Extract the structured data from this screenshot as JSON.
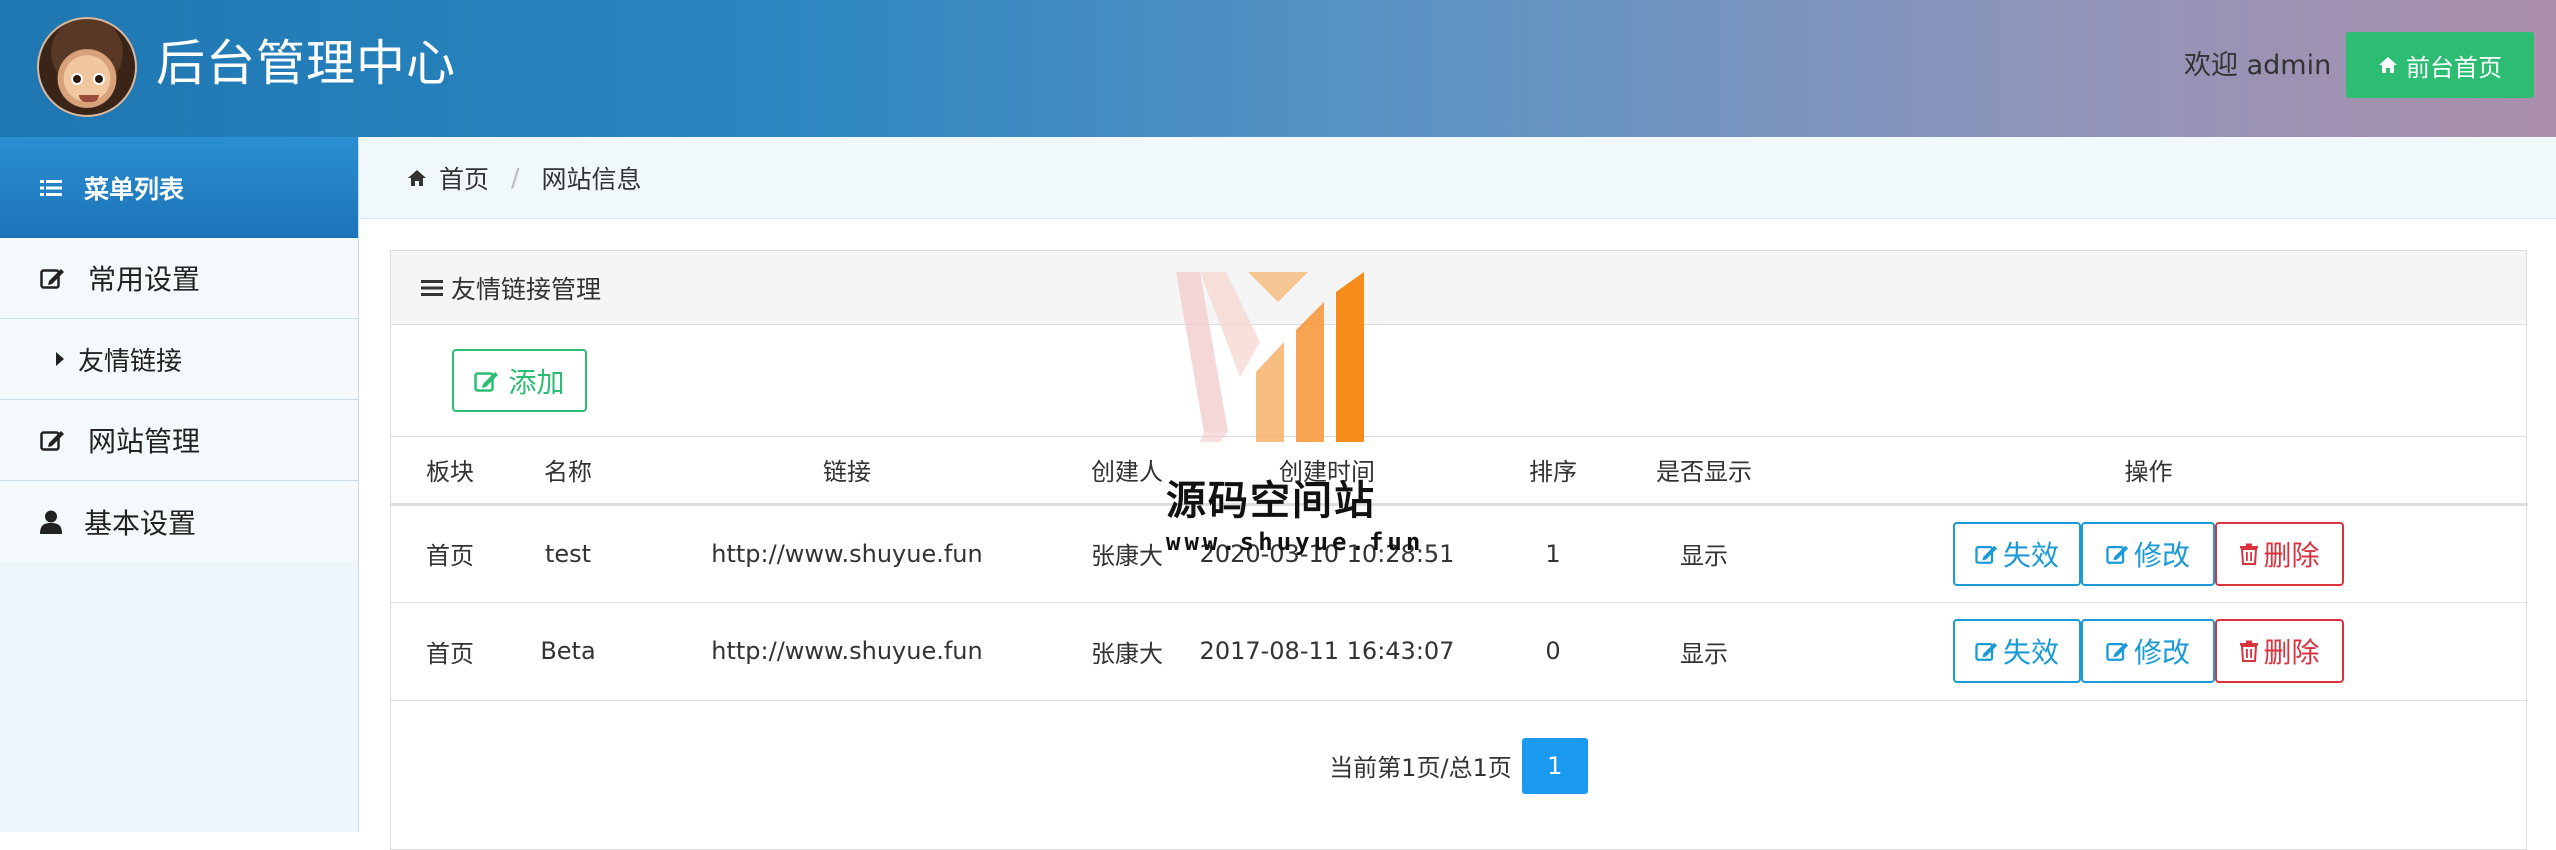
{
  "header": {
    "site_title": "后台管理中心",
    "welcome": "欢迎 admin",
    "front_button": "前台首页"
  },
  "sidebar": {
    "title": "菜单列表",
    "items": [
      {
        "label": "常用设置",
        "icon": "edit-icon"
      },
      {
        "label": "友情链接",
        "icon": "caret-right-icon",
        "sub": true
      },
      {
        "label": "网站管理",
        "icon": "edit-icon"
      },
      {
        "label": "基本设置",
        "icon": "user-icon"
      }
    ]
  },
  "breadcrumb": {
    "home": "首页",
    "current": "网站信息"
  },
  "panel": {
    "title": "友情链接管理",
    "add_button": "添加"
  },
  "table": {
    "columns": [
      "板块",
      "名称",
      "链接",
      "创建人",
      "创建时间",
      "排序",
      "是否显示",
      "操作"
    ],
    "rows": [
      {
        "block": "首页",
        "name": "test",
        "link": "http://www.shuyue.fun",
        "creator": "张康大",
        "created": "2020-03-10 10:28:51",
        "order": "1",
        "shown": "显示"
      },
      {
        "block": "首页",
        "name": "Beta",
        "link": "http://www.shuyue.fun",
        "creator": "张康大",
        "created": "2017-08-11 16:43:07",
        "order": "0",
        "shown": "显示"
      }
    ],
    "actions": {
      "disable": "失效",
      "edit": "修改",
      "delete": "删除"
    }
  },
  "pagination": {
    "status": "当前第1页/总1页",
    "current_page": "1"
  },
  "watermark": {
    "title": "源码空间站",
    "url": "www.shuyue.fun"
  },
  "colors": {
    "header_start": "#1f77b2",
    "header_end": "#ac8fab",
    "success": "#2dbd72",
    "info": "#1a9ad6",
    "danger": "#d9333f",
    "page_active": "#1a9af0"
  }
}
